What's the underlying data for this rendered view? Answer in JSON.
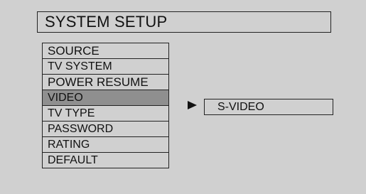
{
  "header": {
    "title": "SYSTEM SETUP"
  },
  "menu": {
    "items": [
      {
        "label": "SOURCE"
      },
      {
        "label": "TV SYSTEM"
      },
      {
        "label": "POWER RESUME"
      },
      {
        "label": "VIDEO"
      },
      {
        "label": "TV TYPE"
      },
      {
        "label": "PASSWORD"
      },
      {
        "label": "RATING"
      },
      {
        "label": "DEFAULT"
      }
    ],
    "selected": "VIDEO"
  },
  "submenu": {
    "pointer_icon": "right-triangle-arrow",
    "value": "S-VIDEO"
  },
  "colors": {
    "background": "#d0d0d0",
    "selected_item": "#8f8f8f",
    "border": "#222222"
  }
}
